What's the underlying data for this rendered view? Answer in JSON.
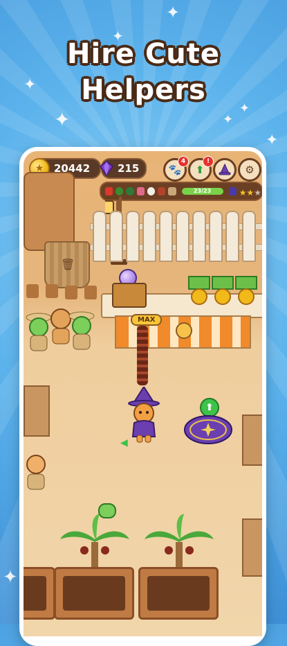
{
  "promo": {
    "headline_line1": "Hire Cute",
    "headline_line2": "Helpers"
  },
  "hud": {
    "coins": "20442",
    "gems": "215",
    "buttons": [
      {
        "name": "helpers",
        "icon": "paw-card-icon",
        "badge": "4"
      },
      {
        "name": "upgrades",
        "icon": "green-arrow-up-icon",
        "badge": "!"
      },
      {
        "name": "wizard-shop",
        "icon": "wizard-hat-icon",
        "badge": ""
      },
      {
        "name": "settings",
        "icon": "gear-icon",
        "badge": ""
      }
    ]
  },
  "quest": {
    "progress_text": "23/23",
    "progress_fraction": 1.0,
    "stars_total": 3,
    "stars_filled": 2
  },
  "scene": {
    "max_label": "MAX",
    "colors": {
      "sky": "#5cb3ec",
      "sand": "#efcd9d",
      "hud_brown": "#5a3a26",
      "coin_gold": "#f1b91a",
      "gem_purple": "#7b3fc9",
      "progress_green": "#7ad14a",
      "cloth_orange": "#f08a2a"
    }
  }
}
